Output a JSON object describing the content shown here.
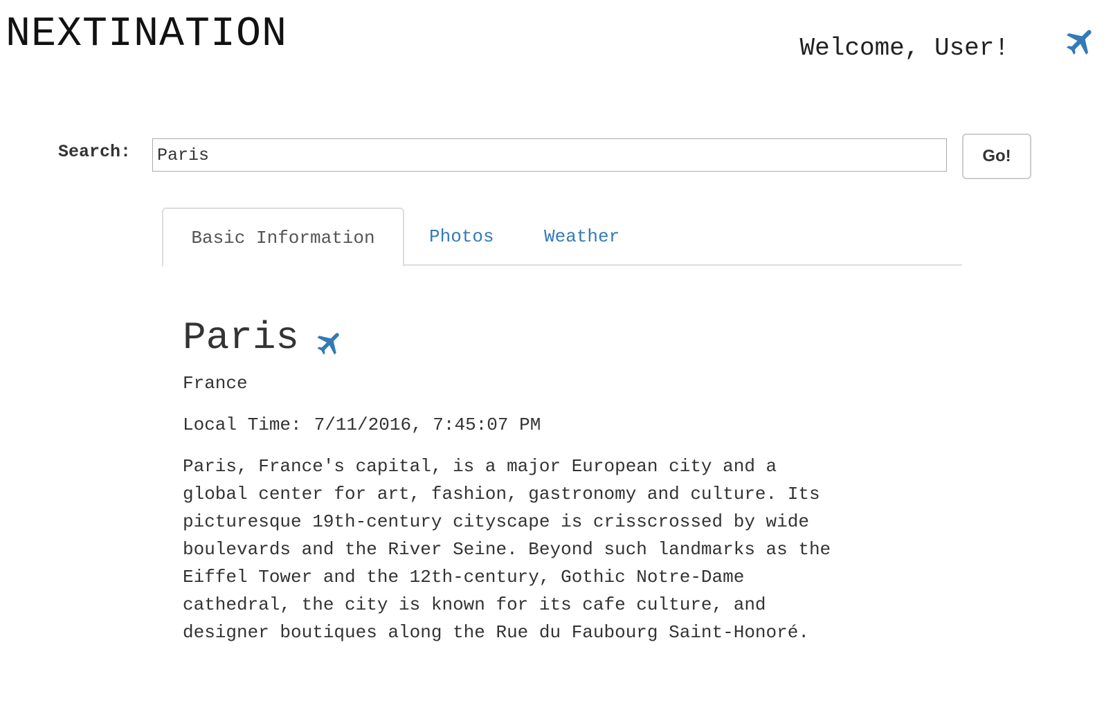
{
  "header": {
    "brand": "NEXTINATION",
    "welcome": "Welcome, User!",
    "plane_icon": "plane-icon",
    "accent_color": "#337ab7"
  },
  "search": {
    "label": "Search:",
    "value": "Paris",
    "button_label": "Go!"
  },
  "tabs": [
    {
      "label": "Basic Information",
      "active": true
    },
    {
      "label": "Photos",
      "active": false
    },
    {
      "label": "Weather",
      "active": false
    }
  ],
  "destination": {
    "city": "Paris",
    "country": "France",
    "local_time_label": "Local Time:",
    "local_time_value": "7/11/2016, 7:45:07 PM",
    "description": "Paris, France's capital, is a major European city and a global center for art, fashion, gastronomy and culture. Its picturesque 19th-century cityscape is crisscrossed by wide boulevards and the River Seine. Beyond such landmarks as the Eiffel Tower and the 12th-century, Gothic Notre-Dame cathedral, the city is known for its cafe culture, and designer boutiques along the Rue du Faubourg Saint-Honoré."
  }
}
